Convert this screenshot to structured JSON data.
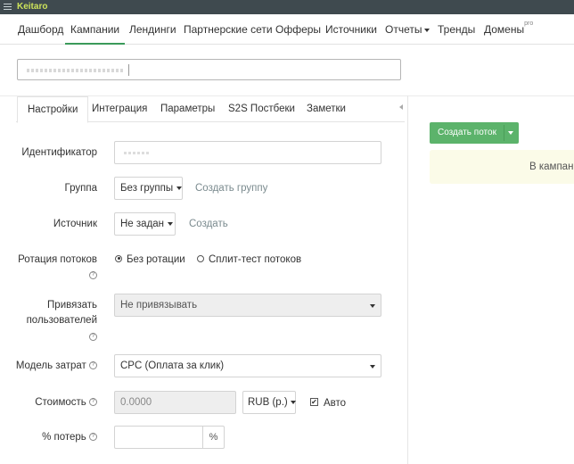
{
  "app": {
    "brand": "Keitaro"
  },
  "nav": {
    "items": [
      {
        "label": "Дашборд"
      },
      {
        "label": "Кампании"
      },
      {
        "label": "Лендинги"
      },
      {
        "label": "Партнерские сети"
      },
      {
        "label": "Офферы"
      },
      {
        "label": "Источники"
      },
      {
        "label": "Отчеты"
      },
      {
        "label": "Тренды"
      },
      {
        "label": "Домены"
      }
    ],
    "active_index": 1,
    "domains_badge": "pro"
  },
  "campaign_name": {
    "value": ""
  },
  "tabs": {
    "items": [
      {
        "label": "Настройки"
      },
      {
        "label": "Интеграция"
      },
      {
        "label": "Параметры"
      },
      {
        "label": "S2S Постбеки"
      },
      {
        "label": "Заметки"
      }
    ],
    "active_index": 0
  },
  "form": {
    "identifier": {
      "label": "Идентификатор",
      "value": ""
    },
    "group": {
      "label": "Группа",
      "value": "Без группы",
      "create_link": "Создать группу"
    },
    "source": {
      "label": "Источник",
      "value": "Не задан",
      "create_link": "Создать"
    },
    "rotation": {
      "label": "Ротация потоков",
      "options": [
        "Без ротации",
        "Сплит-тест потоков"
      ],
      "selected_index": 0
    },
    "bind_users": {
      "label_line1": "Привязать",
      "label_line2": "пользователей",
      "value": "Не привязывать"
    },
    "cost_model": {
      "label": "Модель затрат",
      "value": "CPC (Оплата за клик)"
    },
    "cost": {
      "label": "Стоимость",
      "value": "0.0000",
      "currency": "RUB (р.)",
      "auto_label": "Авто",
      "auto_checked": true
    },
    "loss": {
      "label": "% потерь",
      "value": "",
      "unit": "%"
    }
  },
  "right_panel": {
    "create_stream_button": "Создать поток",
    "info_text": "В кампани"
  },
  "colors": {
    "topbar": "#3f4a4f",
    "brand": "#cde35b",
    "accent_green": "#5cb36b",
    "active_underline": "#3a9a5a",
    "info_bg": "#fbfbe8"
  }
}
